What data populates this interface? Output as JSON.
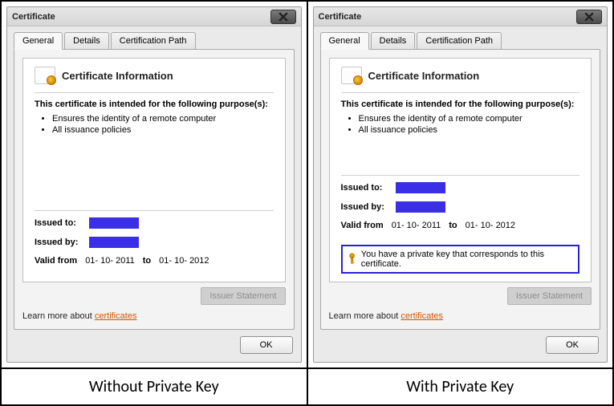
{
  "dialogs": [
    {
      "title": "Certificate",
      "tabs": [
        "General",
        "Details",
        "Certification Path"
      ],
      "active_tab": 0,
      "info_title": "Certificate Information",
      "intended_text": "This certificate is intended for the following purpose(s):",
      "purposes": [
        "Ensures the identity of a remote computer",
        "All issuance policies"
      ],
      "issued_to_label": "Issued to:",
      "issued_by_label": "Issued by:",
      "valid_from_label": "Valid from",
      "valid_from": "01- 10- 2011",
      "valid_to_label": "to",
      "valid_to": "01- 10- 2012",
      "has_private_key": false,
      "private_key_text": "",
      "issuer_statement_label": "Issuer Statement",
      "learn_prefix": "Learn more about ",
      "learn_link": "certificates",
      "ok_label": "OK",
      "caption": "Without Private Key"
    },
    {
      "title": "Certificate",
      "tabs": [
        "General",
        "Details",
        "Certification Path"
      ],
      "active_tab": 0,
      "info_title": "Certificate Information",
      "intended_text": "This certificate is intended for the following purpose(s):",
      "purposes": [
        "Ensures the identity of a remote computer",
        "All issuance policies"
      ],
      "issued_to_label": "Issued to:",
      "issued_by_label": "Issued by:",
      "valid_from_label": "Valid from",
      "valid_from": "01- 10- 2011",
      "valid_to_label": "to",
      "valid_to": "01- 10- 2012",
      "has_private_key": true,
      "private_key_text": "You have a private key that corresponds to this certificate.",
      "issuer_statement_label": "Issuer Statement",
      "learn_prefix": "Learn more about ",
      "learn_link": "certificates",
      "ok_label": "OK",
      "caption": "With Private Key"
    }
  ]
}
